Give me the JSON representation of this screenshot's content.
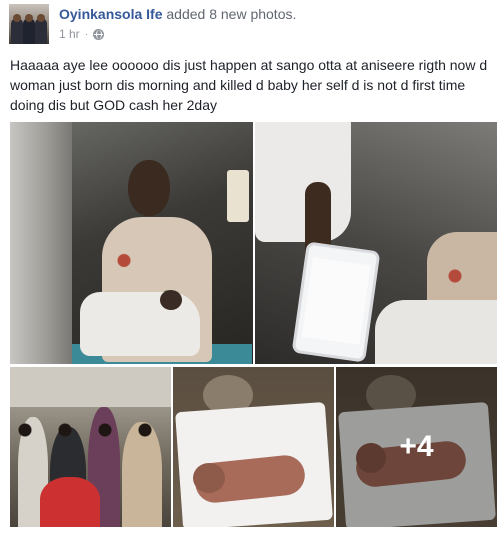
{
  "post": {
    "author": "Oyinkansola Ife",
    "action": "added 8 new photos.",
    "timestamp": "1 hr",
    "privacy_icon": "globe-icon",
    "message": "Haaaaa aye lee oooooo dis just happen at sango otta at aniseere rigth now d woman just born dis morning and killed d baby her self d is not d first time doing dis but GOD cash her 2day",
    "more_photos": "+4"
  },
  "colors": {
    "author_link": "#365899",
    "secondary_text": "#616770",
    "meta_text": "#90949c",
    "body_text": "#1d2129"
  }
}
